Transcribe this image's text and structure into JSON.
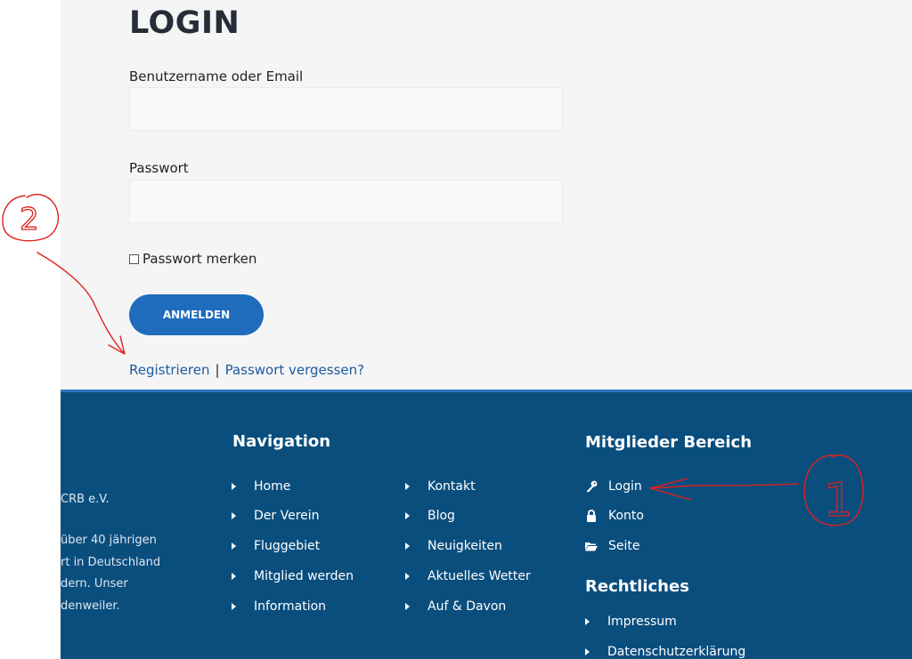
{
  "login": {
    "title": "LOGIN",
    "username_label": "Benutzername oder Email",
    "username_value": "",
    "password_label": "Passwort",
    "password_value": "",
    "remember_label": "Passwort merken",
    "submit_label": "ANMELDEN",
    "register_link": "Registrieren",
    "separator": "|",
    "forgot_link": "Passwort vergessen?"
  },
  "footer": {
    "about_lines": [
      "CRB e.V.",
      "über 40 jährigen",
      "rt in Deutschland",
      "dern. Unser",
      "denweiler."
    ],
    "navigation": {
      "heading": "Navigation",
      "col1": [
        "Home",
        "Der Verein",
        "Fluggebiet",
        "Mitglied werden",
        "Information"
      ],
      "col2": [
        "Kontakt",
        "Blog",
        "Neuigkeiten",
        "Aktuelles Wetter",
        "Auf & Davon"
      ]
    },
    "members": {
      "heading": "Mitglieder Bereich",
      "items": [
        {
          "label": "Login",
          "icon": "key-icon"
        },
        {
          "label": "Konto",
          "icon": "lock-icon"
        },
        {
          "label": "Seite",
          "icon": "folder-open-icon"
        }
      ]
    },
    "legal": {
      "heading": "Rechtliches",
      "items": [
        "Impressum",
        "Datenschutzerklärung"
      ]
    }
  },
  "annotations": {
    "marker_1": "1",
    "marker_2": "2"
  },
  "colors": {
    "content_bg": "#f5f5f5",
    "footer_bg": "#0a4e7e",
    "button": "#1f6cbd",
    "link": "#1d5aa0",
    "annotation": "#e02020"
  }
}
